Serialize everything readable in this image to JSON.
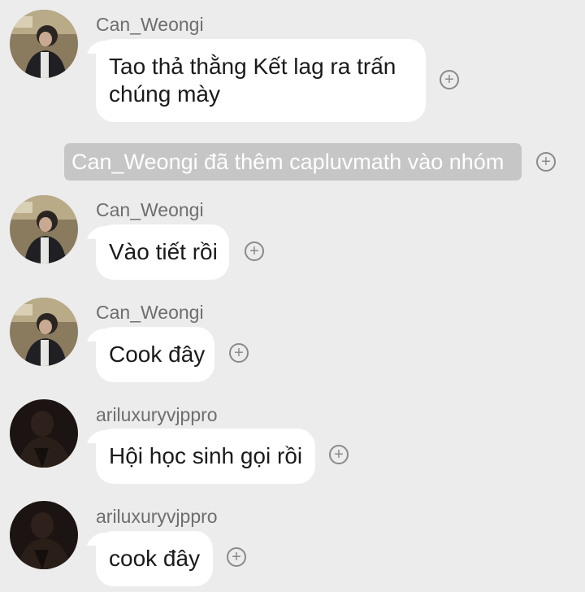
{
  "messages": [
    {
      "sender": "Can_Weongi",
      "lines": [
        "Tao thả thằng Kết lag ra trấn",
        "chúng mày"
      ],
      "avatar": "avatar-light"
    },
    {
      "sender": "Can_Weongi",
      "lines": [
        "Vào tiết rồi"
      ],
      "avatar": "avatar-light"
    },
    {
      "sender": "Can_Weongi",
      "lines": [
        "Cook đây"
      ],
      "avatar": "avatar-light"
    },
    {
      "sender": "ariluxuryvjppro",
      "lines": [
        "Hội học sinh gọi rồi"
      ],
      "avatar": "avatar-dark"
    },
    {
      "sender": "ariluxuryvjppro",
      "lines": [
        "cook đây"
      ],
      "avatar": "avatar-dark"
    }
  ],
  "system_notice": "Can_Weongi đã thêm capluvmath vào nhóm",
  "react_icon": "add-reaction-icon",
  "colors": {
    "background": "#ececec",
    "bubble": "#ffffff",
    "sender_text": "#6e6e6e",
    "system_bg": "#c6c6c6",
    "system_text": "#ffffff"
  }
}
